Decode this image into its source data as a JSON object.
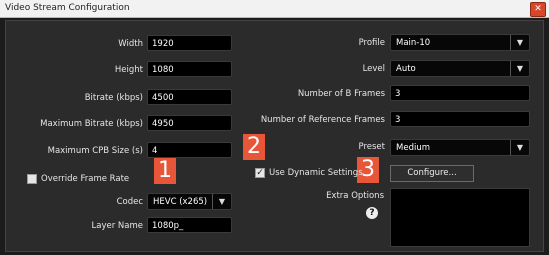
{
  "window": {
    "title": "Video Stream Configuration",
    "close_symbol": "✕"
  },
  "left": {
    "width": {
      "label": "Width",
      "value": "1920"
    },
    "height": {
      "label": "Height",
      "value": "1080"
    },
    "bitrate": {
      "label": "Bitrate (kbps)",
      "value": "4500"
    },
    "max_bitrate": {
      "label": "Maximum Bitrate (kbps)",
      "value": "4950"
    },
    "max_cpb": {
      "label": "Maximum CPB Size (s)",
      "value": "4"
    },
    "override_frame_rate": {
      "label": "Override Frame Rate",
      "checked": false
    },
    "codec": {
      "label": "Codec",
      "value": "HEVC (x265)"
    },
    "layer_name": {
      "label": "Layer Name",
      "value": "1080p_"
    }
  },
  "right": {
    "profile": {
      "label": "Profile",
      "value": "Main-10"
    },
    "level": {
      "label": "Level",
      "value": "Auto"
    },
    "b_frames": {
      "label": "Number of B Frames",
      "value": "3"
    },
    "ref_frames": {
      "label": "Number of Reference Frames",
      "value": "3"
    },
    "preset": {
      "label": "Preset",
      "value": "Medium"
    },
    "dynamic_settings": {
      "label": "Use Dynamic Settings",
      "checked": true,
      "check_mark": "✓"
    },
    "configure_button": "Configure...",
    "extra_options": {
      "label": "Extra Options",
      "help_symbol": "?",
      "value": ""
    }
  },
  "callouts": {
    "one": "1",
    "two": "2",
    "three": "3"
  },
  "icons": {
    "dropdown": "▼"
  },
  "colors": {
    "callout": "#e8563a",
    "panel": "#2b2b2b",
    "field": "#000000",
    "close": "#d9472b"
  }
}
